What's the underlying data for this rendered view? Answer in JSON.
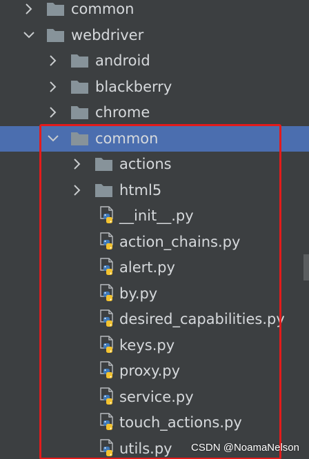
{
  "tree": {
    "rows": [
      {
        "label": "common",
        "type": "folder",
        "depth": 0,
        "expanded": false,
        "selected": false
      },
      {
        "label": "webdriver",
        "type": "folder",
        "depth": 0,
        "expanded": true,
        "selected": false
      },
      {
        "label": "android",
        "type": "folder",
        "depth": 1,
        "expanded": false,
        "selected": false
      },
      {
        "label": "blackberry",
        "type": "folder",
        "depth": 1,
        "expanded": false,
        "selected": false
      },
      {
        "label": "chrome",
        "type": "folder",
        "depth": 1,
        "expanded": false,
        "selected": false
      },
      {
        "label": "common",
        "type": "folder",
        "depth": 1,
        "expanded": true,
        "selected": true
      },
      {
        "label": "actions",
        "type": "folder",
        "depth": 2,
        "expanded": false,
        "selected": false
      },
      {
        "label": "html5",
        "type": "folder",
        "depth": 2,
        "expanded": false,
        "selected": false
      },
      {
        "label": "__init__.py",
        "type": "python-file",
        "depth": 2,
        "selected": false
      },
      {
        "label": "action_chains.py",
        "type": "python-file",
        "depth": 2,
        "selected": false
      },
      {
        "label": "alert.py",
        "type": "python-file",
        "depth": 2,
        "selected": false
      },
      {
        "label": "by.py",
        "type": "python-file",
        "depth": 2,
        "selected": false
      },
      {
        "label": "desired_capabilities.py",
        "type": "python-file",
        "depth": 2,
        "selected": false
      },
      {
        "label": "keys.py",
        "type": "python-file",
        "depth": 2,
        "selected": false
      },
      {
        "label": "proxy.py",
        "type": "python-file",
        "depth": 2,
        "selected": false
      },
      {
        "label": "service.py",
        "type": "python-file",
        "depth": 2,
        "selected": false
      },
      {
        "label": "touch_actions.py",
        "type": "python-file",
        "depth": 2,
        "selected": false
      },
      {
        "label": "utils.py",
        "type": "python-file",
        "depth": 2,
        "selected": false
      }
    ]
  },
  "colors": {
    "background": "#3c3f41",
    "selection": "#4b6eaf",
    "text": "#d6d9dc",
    "folder": "#87939a",
    "arrow": "#c9ccce",
    "highlight": "#e31b1b",
    "python_blue": "#3f79b8",
    "python_yellow": "#f2c230"
  },
  "watermark": "CSDN @NoamaNelson"
}
